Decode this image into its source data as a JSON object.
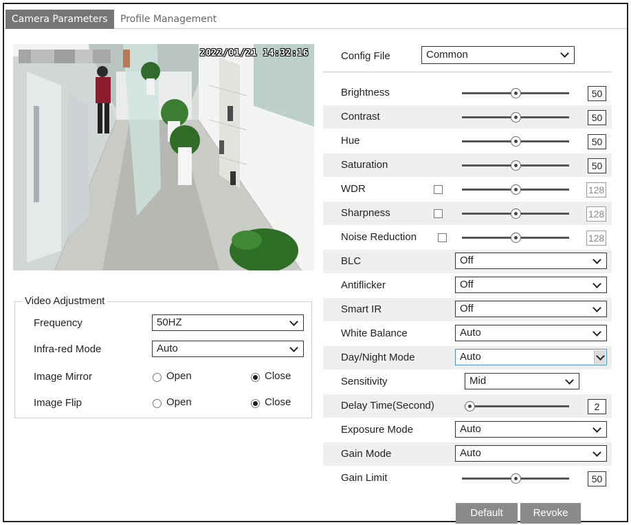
{
  "tabs": [
    {
      "label": "Camera Parameters",
      "active": true
    },
    {
      "label": "Profile Management",
      "active": false
    }
  ],
  "video": {
    "timestamp": "2022/01/21 14:32:16"
  },
  "video_adjustment": {
    "title": "Video Adjustment",
    "frequency": {
      "label": "Frequency",
      "value": "50HZ"
    },
    "infrared": {
      "label": "Infra-red Mode",
      "value": "Auto"
    },
    "mirror": {
      "label": "Image Mirror",
      "open": "Open",
      "close": "Close",
      "selected": "Close"
    },
    "flip": {
      "label": "Image Flip",
      "open": "Open",
      "close": "Close",
      "selected": "Close"
    }
  },
  "config_file": {
    "label": "Config File",
    "value": "Common"
  },
  "params": {
    "brightness": {
      "label": "Brightness",
      "value": "50",
      "level": 0.5
    },
    "contrast": {
      "label": "Contrast",
      "value": "50",
      "level": 0.5
    },
    "hue": {
      "label": "Hue",
      "value": "50",
      "level": 0.5
    },
    "saturation": {
      "label": "Saturation",
      "value": "50",
      "level": 0.5
    },
    "wdr": {
      "label": "WDR",
      "value": "128",
      "level": 0.5,
      "checked": false
    },
    "sharpness": {
      "label": "Sharpness",
      "value": "128",
      "level": 0.5,
      "checked": false
    },
    "noise_reduction": {
      "label": "Noise Reduction",
      "value": "128",
      "level": 0.5,
      "checked": false
    },
    "blc": {
      "label": "BLC",
      "value": "Off"
    },
    "antiflicker": {
      "label": "Antiflicker",
      "value": "Off"
    },
    "smart_ir": {
      "label": "Smart IR",
      "value": "Off"
    },
    "white_balance": {
      "label": "White Balance",
      "value": "Auto"
    },
    "day_night": {
      "label": "Day/Night Mode",
      "value": "Auto"
    },
    "sensitivity": {
      "label": "Sensitivity",
      "value": "Mid"
    },
    "delay_time": {
      "label": "Delay Time(Second)",
      "value": "2",
      "level": 0.0
    },
    "exposure_mode": {
      "label": "Exposure Mode",
      "value": "Auto"
    },
    "gain_mode": {
      "label": "Gain Mode",
      "value": "Auto"
    },
    "gain_limit": {
      "label": "Gain Limit",
      "value": "50",
      "level": 0.5
    }
  },
  "buttons": {
    "default": "Default",
    "revoke": "Revoke"
  },
  "colors": {
    "tab_active": "#767676",
    "button": "#8a8a8a",
    "row_shade": "#efefef",
    "focus": "#4d8fd6"
  }
}
